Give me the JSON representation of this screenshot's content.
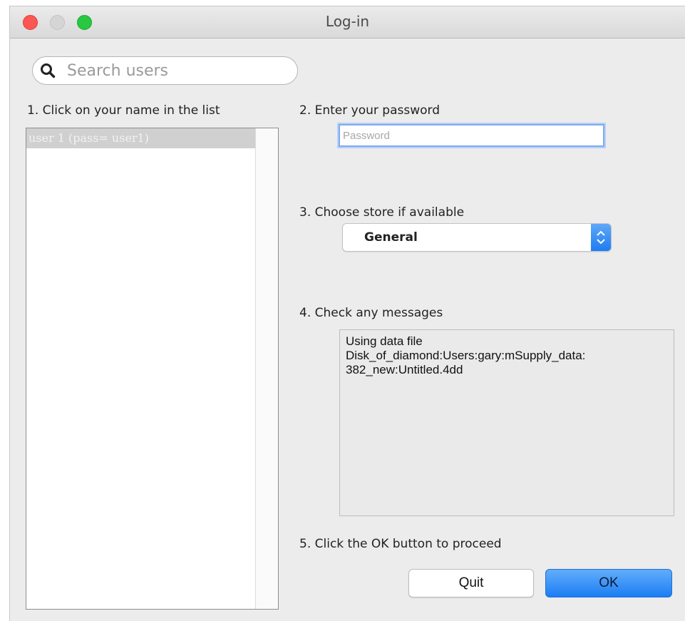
{
  "window": {
    "title": "Log-in"
  },
  "search": {
    "placeholder": "Search users",
    "value": ""
  },
  "steps": {
    "step1": "1. Click on your name in the list",
    "step2": "2. Enter your password",
    "step3": "3. Choose store if available",
    "step4": "4. Check any messages",
    "step5": "5. Click the OK button to proceed"
  },
  "users": {
    "items": [
      {
        "label": "user 1 (pass= user1)",
        "selected": true
      }
    ]
  },
  "password": {
    "placeholder": "Password",
    "value": ""
  },
  "store": {
    "selected": "General"
  },
  "messages": {
    "lines": [
      "Using data file",
      "Disk_of_diamond:Users:gary:mSupply_data:",
      "382_new:Untitled.4dd"
    ]
  },
  "buttons": {
    "quit": "Quit",
    "ok": "OK"
  },
  "icons": {
    "search": "search-icon",
    "select_arrows": "chevron-up-down-icon"
  },
  "colors": {
    "accent": "#1f7cf3",
    "close": "#fc5753",
    "minimize": "#d5d5d5",
    "zoom": "#28c840",
    "selected_row": "#d0d0d0"
  }
}
